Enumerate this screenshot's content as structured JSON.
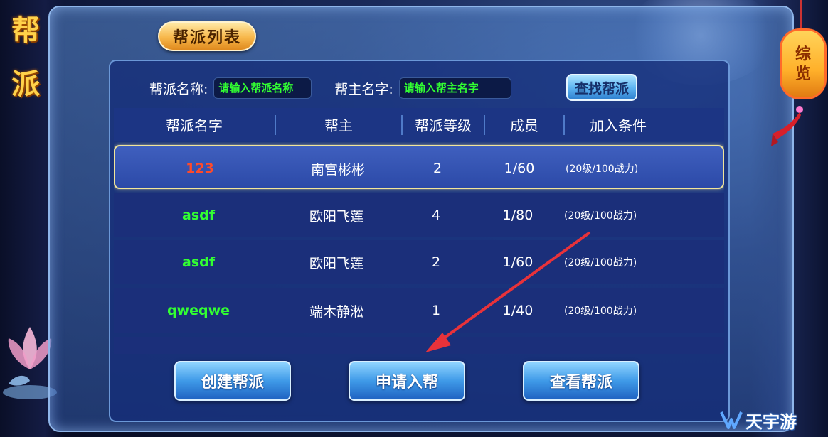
{
  "side_title": [
    "帮",
    "派"
  ],
  "tab_label": "帮派列表",
  "search": {
    "name_label": "帮派名称:",
    "name_placeholder": "请输入帮派名称",
    "leader_label": "帮主名字:",
    "leader_placeholder": "请输入帮主名字",
    "find_button": "查找帮派"
  },
  "columns": [
    "帮派名字",
    "帮主",
    "帮派等级",
    "成员",
    "加入条件"
  ],
  "rows": [
    {
      "name": "123",
      "leader": "南宫彬彬",
      "level": "2",
      "members": "1/60",
      "condition": "(20级/100战力)",
      "name_color": "#ff4a2a",
      "selected": true
    },
    {
      "name": "asdf",
      "leader": "欧阳飞莲",
      "level": "4",
      "members": "1/80",
      "condition": "(20级/100战力)",
      "name_color": "#32ff32",
      "selected": false
    },
    {
      "name": "asdf",
      "leader": "欧阳飞莲",
      "level": "2",
      "members": "1/60",
      "condition": "(20级/100战力)",
      "name_color": "#32ff32",
      "selected": false
    },
    {
      "name": "qweqwe",
      "leader": "端木静淞",
      "level": "1",
      "members": "1/40",
      "condition": "(20级/100战力)",
      "name_color": "#32ff32",
      "selected": false
    },
    {
      "name": "",
      "leader": "",
      "level": "",
      "members": "",
      "condition": "",
      "name_color": "#32a8ff",
      "selected": false
    }
  ],
  "buttons": {
    "create": "创建帮派",
    "apply": "申请入帮",
    "view": "查看帮派"
  },
  "lantern_text": [
    "综",
    "览"
  ],
  "watermark": "天宇游",
  "colors": {
    "accent_gold": "#ffd24a",
    "name_red": "#ff4a2a",
    "name_green": "#32ff32",
    "panel_blue": "#1b2f7a",
    "annotation_arrow": "#e8323a"
  }
}
